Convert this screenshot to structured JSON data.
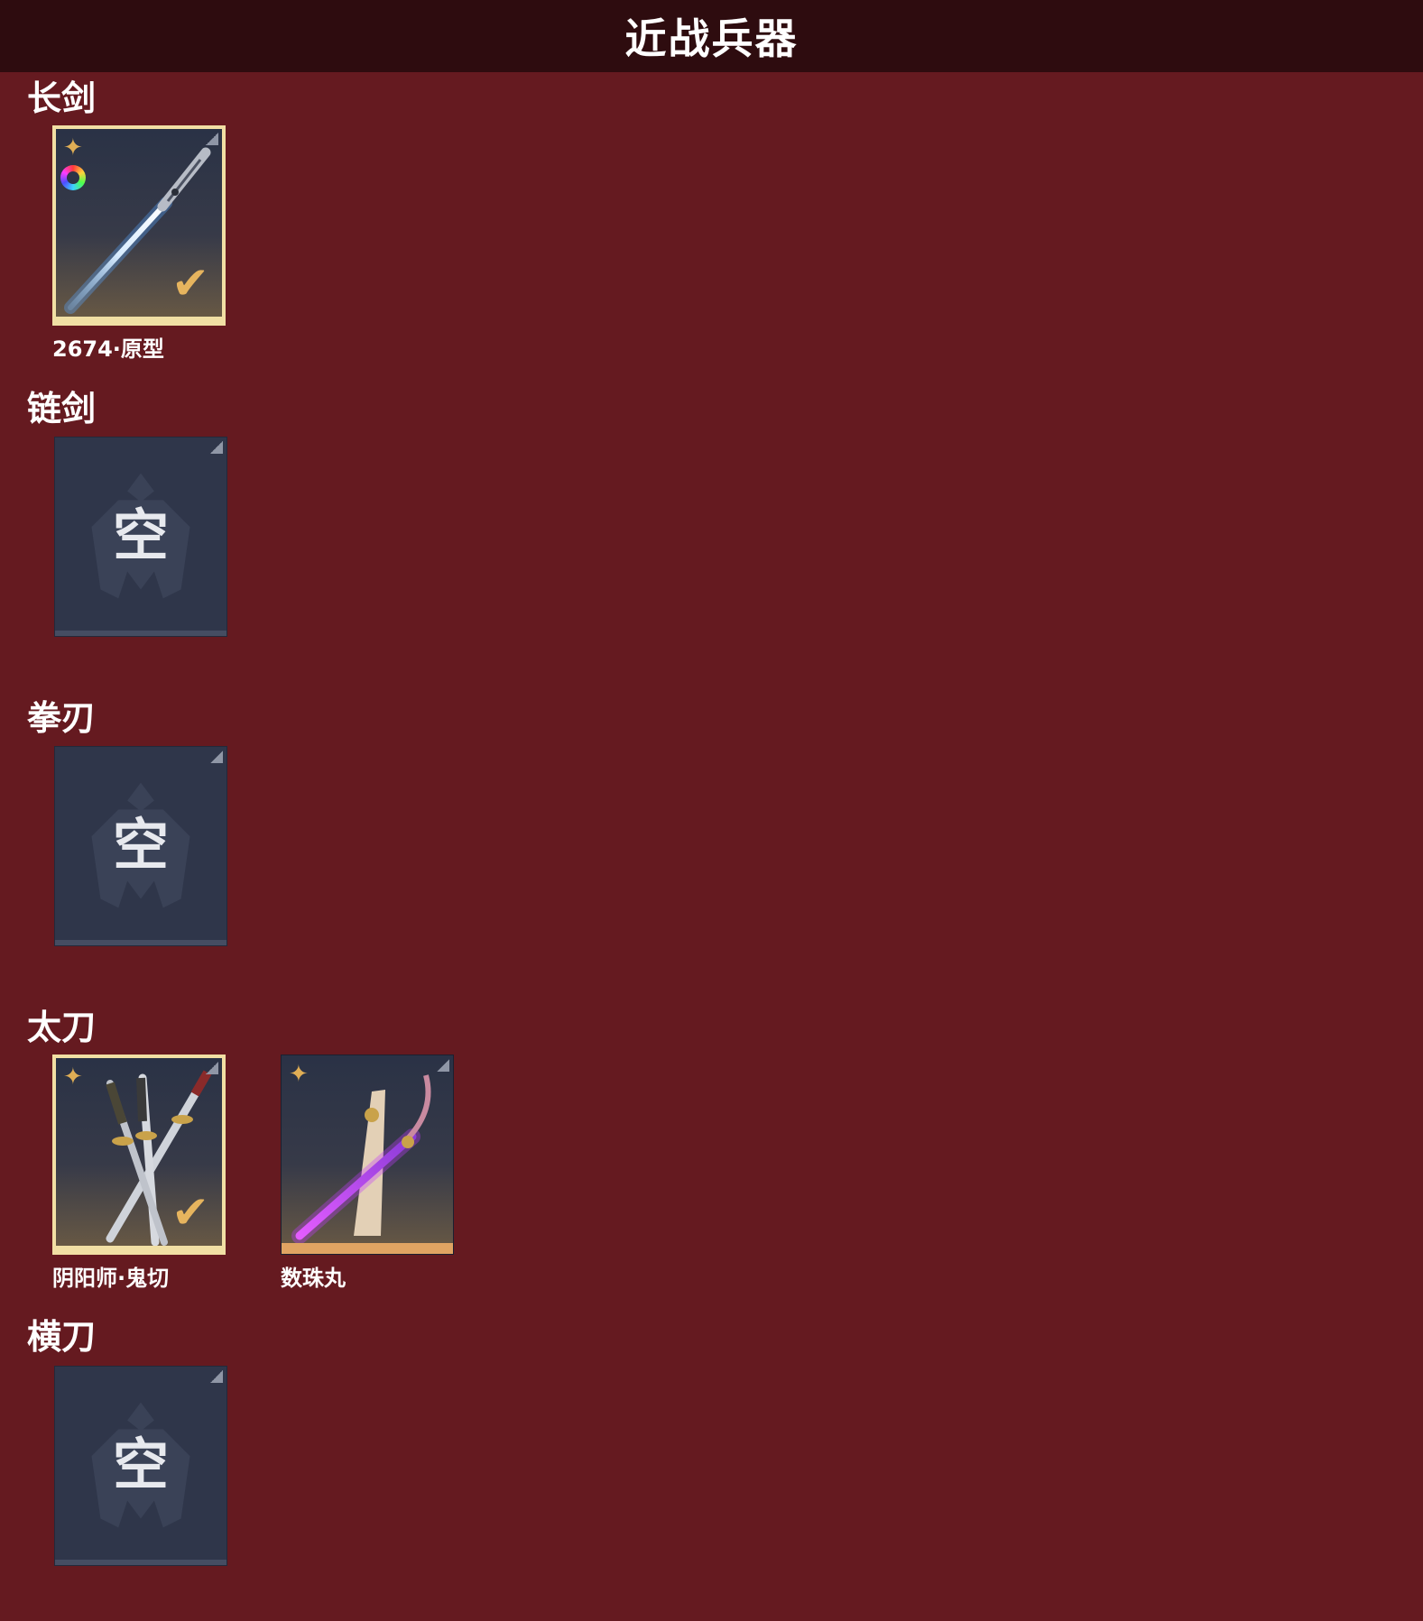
{
  "header": {
    "title": "近战兵器"
  },
  "sections": [
    {
      "title": "长剑",
      "items": [
        {
          "name": "2674·原型",
          "state": "equipped",
          "empty_label": ""
        }
      ]
    },
    {
      "title": "链剑",
      "items": [
        {
          "name": "",
          "state": "empty",
          "empty_label": "空"
        }
      ]
    },
    {
      "title": "拳刃",
      "items": [
        {
          "name": "",
          "state": "empty",
          "empty_label": "空"
        }
      ]
    },
    {
      "title": "太刀",
      "items": [
        {
          "name": "阴阳师·鬼切",
          "state": "equipped",
          "empty_label": ""
        },
        {
          "name": "数珠丸",
          "state": "owned",
          "empty_label": ""
        }
      ]
    },
    {
      "title": "横刀",
      "items": [
        {
          "name": "",
          "state": "empty",
          "empty_label": "空"
        }
      ]
    }
  ],
  "icons": {
    "rarity": "four-point-star-icon",
    "dye": "color-wheel-icon",
    "equipped": "checkmark-icon",
    "corner": "corner-tag-icon",
    "empty": "warrior-emblem-icon"
  },
  "colors": {
    "background": "#651a20",
    "header_bar": "#2e0c0f",
    "owned_border": "#f1dfa4",
    "rare_bottom": "#e0a462",
    "empty_slot": "#2f364a",
    "rarity_icon": "#e0ae55"
  }
}
